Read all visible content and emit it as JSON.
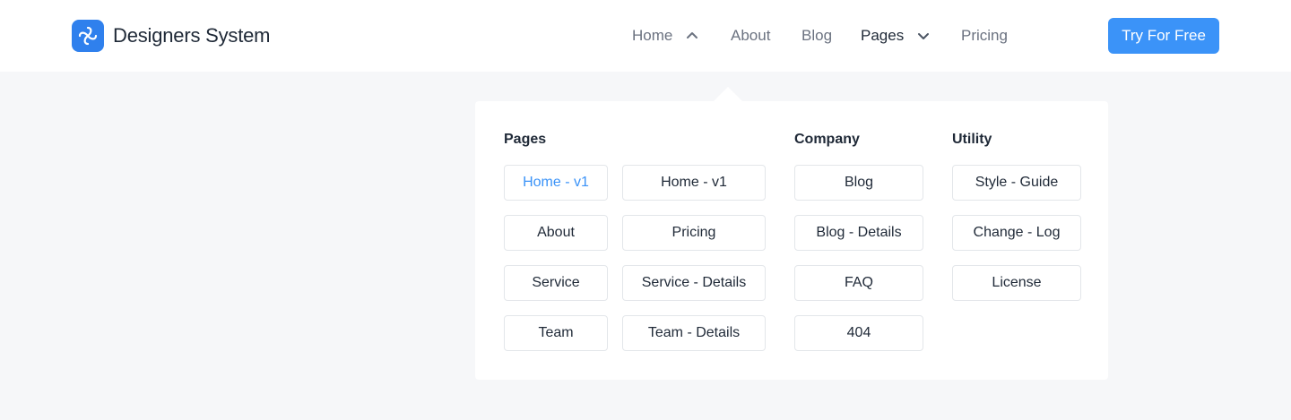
{
  "brand": {
    "name": "Designers System",
    "accent": "#2f80ed"
  },
  "nav": {
    "items": [
      {
        "label": "Home"
      },
      {
        "label": "About"
      },
      {
        "label": "Blog"
      },
      {
        "label": "Pages"
      },
      {
        "label": "Pricing"
      }
    ],
    "cta_label": "Try For Free"
  },
  "dropdown": {
    "pages": {
      "title": "Pages",
      "col1": [
        "Home - v1",
        "About",
        "Service",
        "Team"
      ],
      "col2": [
        "Home - v1",
        "Pricing",
        "Service - Details",
        "Team - Details"
      ]
    },
    "company": {
      "title": "Company",
      "items": [
        "Blog",
        "Blog - Details",
        "FAQ",
        "404"
      ]
    },
    "utility": {
      "title": "Utility",
      "items": [
        "Style - Guide",
        "Change - Log",
        "License"
      ]
    }
  },
  "colors": {
    "cta": "#3b93f8",
    "highlight": "#3b93f8",
    "background": "#f6f7f9"
  }
}
